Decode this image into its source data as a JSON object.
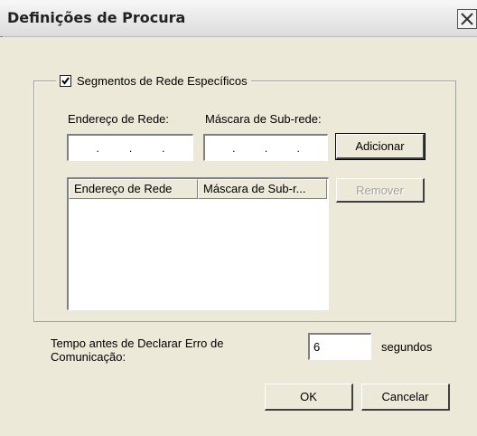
{
  "window": {
    "title": "Definições de Procura",
    "close_label": "✕"
  },
  "group": {
    "checkbox_label": "Segmentos de Rede Específicos",
    "checked": true
  },
  "fields": {
    "address_label": "Endereço de Rede:",
    "mask_label": "Máscara de Sub-rede:",
    "address_value": ". . .",
    "mask_value": ". . ."
  },
  "buttons": {
    "add": "Adicionar",
    "remove": "Remover",
    "ok": "OK",
    "cancel": "Cancelar"
  },
  "list": {
    "columns": [
      "Endereço de Rede",
      "Máscara de Sub-r..."
    ],
    "rows": []
  },
  "timeout": {
    "label_line1": "Tempo antes de Declarar Erro de",
    "label_line2": "Comunicação:",
    "value": "6",
    "unit": "segundos"
  }
}
